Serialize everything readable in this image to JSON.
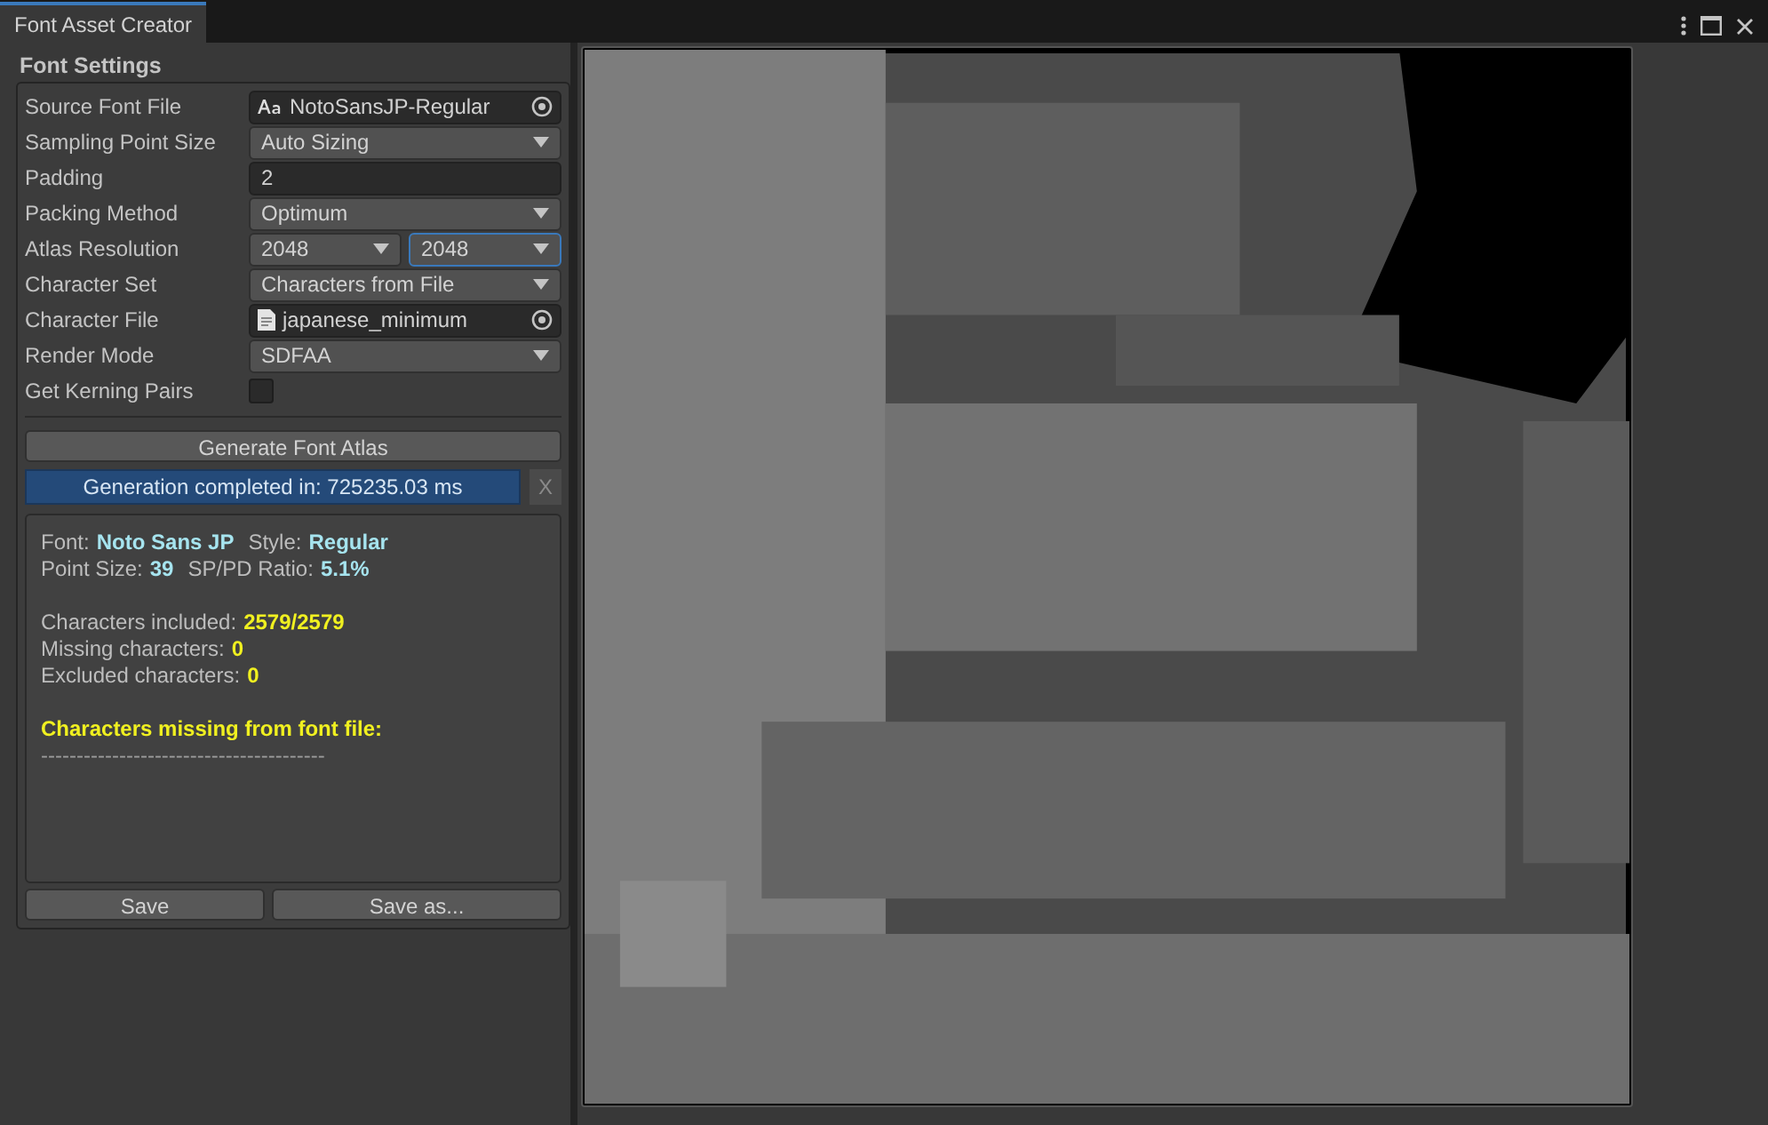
{
  "window": {
    "tab": "Font Asset Creator"
  },
  "settings": {
    "title": "Font Settings",
    "fields": [
      {
        "label": "Source Font File",
        "kind": "font_object",
        "value": "NotoSansJP-Regular"
      },
      {
        "label": "Sampling Point Size",
        "kind": "dropdown",
        "value": "Auto Sizing"
      },
      {
        "label": "Padding",
        "kind": "text",
        "value": "2"
      },
      {
        "label": "Packing Method",
        "kind": "dropdown",
        "value": "Optimum"
      },
      {
        "label": "Atlas Resolution",
        "kind": "dropdown_pair",
        "values": [
          {
            "value": "2048",
            "focused": false
          },
          {
            "value": "2048",
            "focused": true
          }
        ]
      },
      {
        "label": "Character Set",
        "kind": "dropdown",
        "value": "Characters from File"
      },
      {
        "label": "Character File",
        "kind": "file_object",
        "value": "japanese_minimum"
      },
      {
        "label": "Render Mode",
        "kind": "dropdown",
        "value": "SDFAA"
      },
      {
        "label": "Get Kerning Pairs",
        "kind": "checkbox",
        "checked": false
      }
    ]
  },
  "generate_button": "Generate Font Atlas",
  "status": {
    "text": "Generation completed in: 725235.03 ms",
    "close": "X"
  },
  "info": {
    "groups": [
      [
        [
          {
            "label": "Font:",
            "value": "Noto Sans JP",
            "color": "#a6e4ef"
          },
          {
            "label": "Style:",
            "value": "Regular",
            "color": "#a6e4ef"
          }
        ],
        [
          {
            "label": "Point Size:",
            "value": "39",
            "color": "#a6e4ef"
          },
          {
            "label": "SP/PD Ratio:",
            "value": "5.1%",
            "color": "#a6e4ef"
          }
        ]
      ],
      [
        [
          {
            "label": "Characters included:",
            "value": "2579/2579",
            "color": "#f0f020"
          }
        ],
        [
          {
            "label": "Missing characters:",
            "value": "0",
            "color": "#f0f020"
          }
        ],
        [
          {
            "label": "Excluded characters:",
            "value": "0",
            "color": "#f0f020"
          }
        ]
      ]
    ],
    "heading": "Characters missing from font file:",
    "rule": "----------------------------------------"
  },
  "buttons": [
    "Save",
    "Save as..."
  ],
  "preview": {
    "kind": "picture"
  }
}
